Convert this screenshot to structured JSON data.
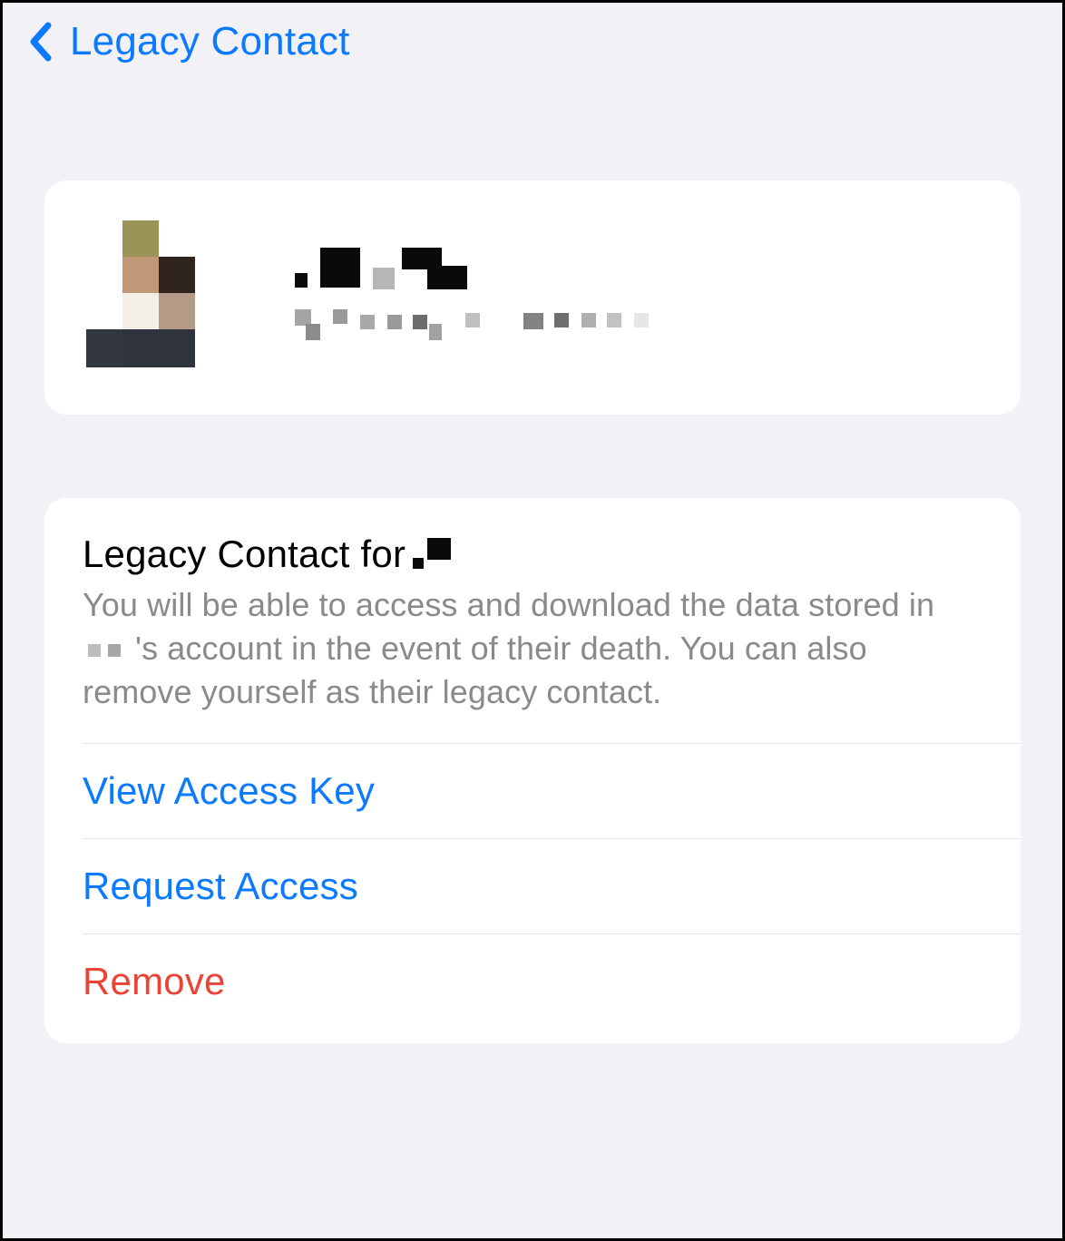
{
  "nav": {
    "title": "Legacy Contact"
  },
  "contact": {
    "name_redacted": true,
    "subtitle_redacted": true
  },
  "details": {
    "title_prefix": "Legacy Contact for ",
    "desc_1": "You will be able to access and download the data stored in ",
    "desc_2": "'s account in the event of their death. You can also remove yourself as their legacy contact."
  },
  "actions": {
    "view_key": "View Access Key",
    "request_access": "Request Access",
    "remove": "Remove"
  }
}
